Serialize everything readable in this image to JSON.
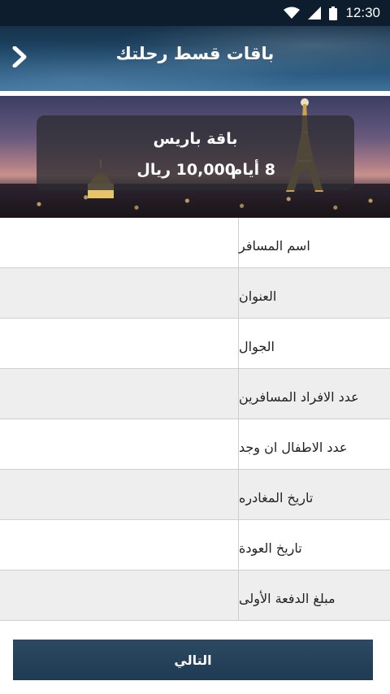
{
  "status_bar": {
    "time": "12:30",
    "icons": [
      "wifi-icon",
      "signal-icon",
      "battery-icon"
    ]
  },
  "header": {
    "title": "باقات قسط رحلتك",
    "back_icon": "chevron-right-icon"
  },
  "package": {
    "name": "باقة باريس",
    "duration": "8 أيام",
    "price": "10,000 ريال"
  },
  "form": {
    "fields": [
      {
        "label": "اسم المسافر",
        "value": ""
      },
      {
        "label": "العنوان",
        "value": ""
      },
      {
        "label": "الجوال",
        "value": ""
      },
      {
        "label": "عدد الافراد المسافرين",
        "value": ""
      },
      {
        "label": "عدد الاطفال ان وجد",
        "value": ""
      },
      {
        "label": "تاريخ المغادره",
        "value": ""
      },
      {
        "label": "تاريخ العودة",
        "value": ""
      },
      {
        "label": "مبلغ الدفعة الأولى",
        "value": ""
      }
    ]
  },
  "actions": {
    "next_label": "التالي"
  },
  "colors": {
    "header_bg": "#1e4769",
    "button_bg": "#243f57",
    "row_alt_bg": "#eeeeee"
  }
}
